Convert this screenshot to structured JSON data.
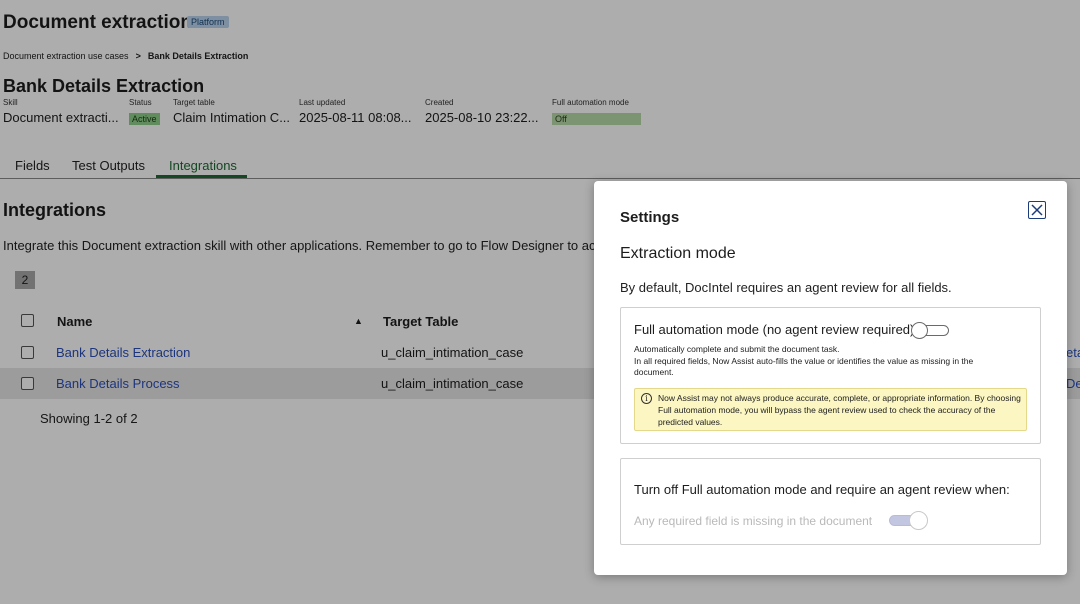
{
  "header": {
    "app_title": "Document extraction",
    "platform_badge": "Platform"
  },
  "breadcrumb": {
    "parent": "Document extraction use cases",
    "separator": ">",
    "current": "Bank Details Extraction"
  },
  "record": {
    "title": "Bank Details Extraction",
    "fields": {
      "skill": {
        "label": "Skill",
        "value": "Document extracti..."
      },
      "status": {
        "label": "Status",
        "value": "Active"
      },
      "target_table": {
        "label": "Target table",
        "value": "Claim Intimation C..."
      },
      "last_updated": {
        "label": "Last updated",
        "value": "2025-08-11 08:08..."
      },
      "created": {
        "label": "Created",
        "value": "2025-08-10 23:22..."
      },
      "full_automation": {
        "label": "Full automation mode",
        "value": "Off"
      }
    }
  },
  "tabs": [
    {
      "label": "Fields"
    },
    {
      "label": "Test Outputs"
    },
    {
      "label": "Integrations",
      "active": true
    }
  ],
  "integrations": {
    "title": "Integrations",
    "description": "Integrate this Document extraction skill with other applications. Remember to go to Flow Designer to activa",
    "count": "2",
    "columns": {
      "name": "Name",
      "target_table": "Target Table"
    },
    "rows": [
      {
        "name": "Bank Details Extraction",
        "target_table": "u_claim_intimation_case",
        "cut": "eta"
      },
      {
        "name": "Bank Details Process",
        "target_table": "u_claim_intimation_case",
        "cut": "De"
      }
    ],
    "showing": "Showing 1-2 of 2"
  },
  "modal": {
    "title": "Settings",
    "section_title": "Extraction mode",
    "description": "By default, DocIntel requires an agent review for all fields.",
    "full_automation": {
      "title": "Full automation mode (no agent review required)",
      "enabled": false,
      "help_line1": "Automatically complete and submit the document task.",
      "help_line2": "In all required fields, Now Assist auto-fills the value or identifies the value as missing in the document.",
      "warning": "Now Assist may not always produce accurate, complete, or appropriate information. By choosing Full automation mode, you will bypass the agent review used to check the accuracy of the predicted values."
    },
    "turn_off": {
      "title": "Turn off Full automation mode and require an agent review when:",
      "option_label": "Any required field is missing in the document",
      "option_enabled": true,
      "disabled": true
    }
  },
  "colors": {
    "accent_green": "#1e6b33",
    "link_blue": "#2c4fb8",
    "warning_bg": "#fbf6c2"
  }
}
